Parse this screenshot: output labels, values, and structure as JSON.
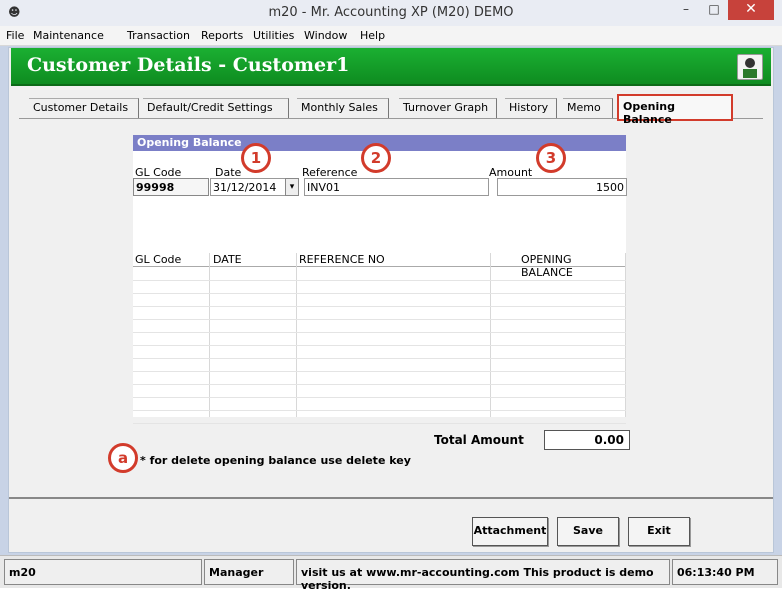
{
  "window": {
    "title": "m20 - Mr. Accounting XP (M20) DEMO",
    "minimize": "–",
    "maximize": "□",
    "close": "✕"
  },
  "menu": {
    "file": "File",
    "maintenance": "Maintenance",
    "transaction": "Transaction",
    "reports": "Reports",
    "utilities": "Utilities",
    "window": "Window",
    "help": "Help"
  },
  "banner": {
    "title": "Customer Details  -  Customer1"
  },
  "tabs": [
    {
      "label": "Customer Details"
    },
    {
      "label": "Default/Credit Settings"
    },
    {
      "label": "Monthly Sales"
    },
    {
      "label": "Turnover Graph"
    },
    {
      "label": "History"
    },
    {
      "label": "Memo"
    },
    {
      "label": "Opening Balance"
    }
  ],
  "opening_balance": {
    "header": "Opening Balance",
    "labels": {
      "gl_code": "GL Code",
      "date": "Date",
      "reference": "Reference",
      "amount": "Amount"
    },
    "values": {
      "gl_code": "99998",
      "date": "31/12/2014",
      "reference": "INV01",
      "amount": "1500"
    },
    "grid_columns": [
      "GL Code",
      "DATE",
      "REFERENCE NO",
      "OPENING BALANCE"
    ],
    "markers": [
      "1",
      "2",
      "3",
      "a"
    ]
  },
  "totals": {
    "label": "Total Amount",
    "value": "0.00"
  },
  "note": "* for delete opening balance use delete key",
  "buttons": {
    "attachment": "Attachment",
    "save": "Save",
    "exit": "Exit"
  },
  "status": {
    "app": "m20",
    "user": "Manager",
    "message": "visit us at www.mr-accounting.com This product is demo version.",
    "time": "06:13:40 PM"
  },
  "colors": {
    "banner_green": "#15a12b",
    "panel_header": "#7b7fc7",
    "highlight_red": "#d23b2b"
  }
}
